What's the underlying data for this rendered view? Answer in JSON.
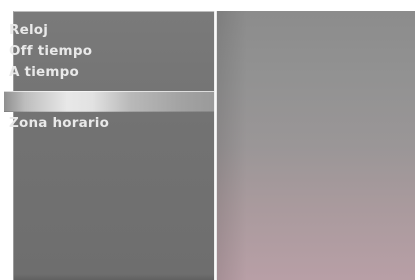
{
  "menu": {
    "items": [
      {
        "label": "Reloj"
      },
      {
        "label": "Off tiempo"
      },
      {
        "label": "A tiempo"
      }
    ],
    "selected_item": {
      "label": ""
    },
    "after_items": [
      {
        "label": "Zona horario"
      }
    ]
  }
}
